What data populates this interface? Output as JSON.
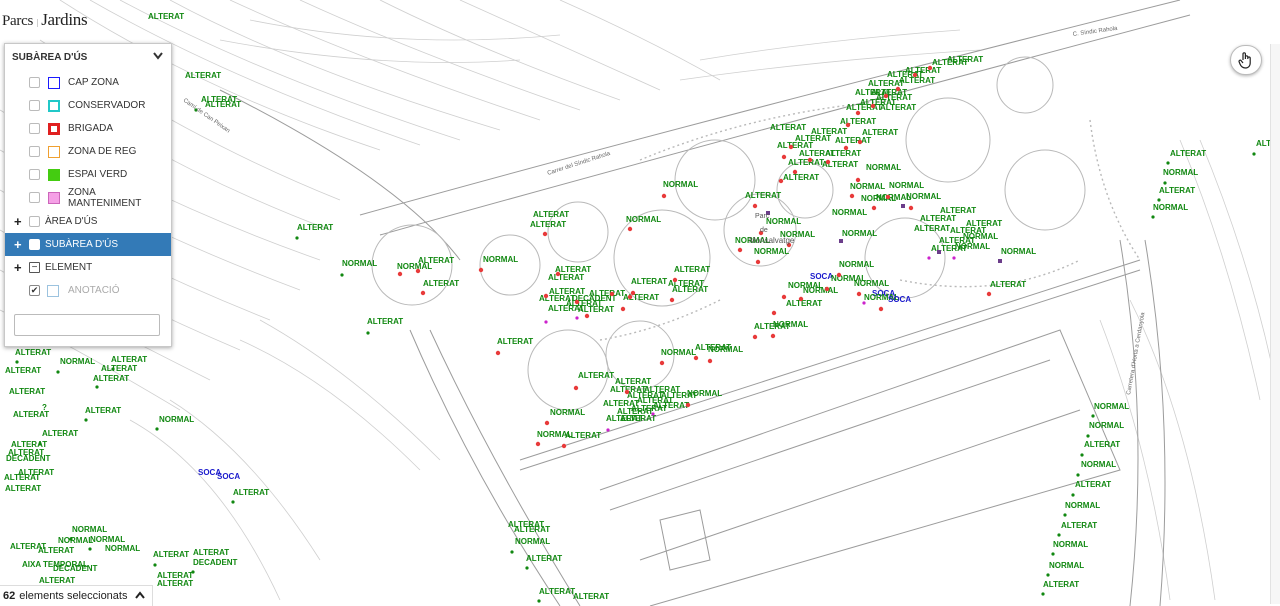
{
  "brand": {
    "part1": "Parcs",
    "part2": "Jardins"
  },
  "street_labels": [
    "Carrer del Síndic Rahola",
    "C. Síndic Rahola",
    "Camí de Can Peixan",
    "Carretera d'Horta a Cerdanyola"
  ],
  "park_labels": [
    "Parc",
    "de",
    "Monsalvatge"
  ],
  "panel": {
    "title": "SUBÀREA D'ÚS",
    "legend": [
      {
        "label": "CAP ZONA",
        "color": "#1a1aff",
        "style": "outline"
      },
      {
        "label": "CONSERVADOR",
        "color": "#21c8c8",
        "style": "dashed"
      },
      {
        "label": "BRIGADA",
        "color": "#e02020",
        "style": "thick"
      },
      {
        "label": "ZONA DE REG",
        "color": "#f0a030",
        "style": "outline"
      },
      {
        "label": "ESPAI VERD",
        "color": "#44cc11",
        "style": "fill"
      },
      {
        "label": "ZONA MANTENIMENT",
        "color": "#f5a0e6",
        "style": "fillborder"
      }
    ],
    "groups": [
      {
        "label": "ÀREA D'ÚS"
      },
      {
        "label": "SUBÀREA D'ÚS"
      },
      {
        "label": "ELEMENT"
      },
      {
        "label": "ANOTACIÓ"
      }
    ],
    "search_value": ""
  },
  "colors": {
    "green": "#118811",
    "blue": "#1a1acc",
    "red": "#e83a3a",
    "purple": "#6b3d8a",
    "magenta": "#cc22cc",
    "active": "#337ab7"
  },
  "status": {
    "count": "62",
    "text": "elements seleccionats"
  },
  "tool_icon": "hand-pointer-icon",
  "map_labels": [
    [
      "ALTERAT",
      "green",
      148,
      19
    ],
    [
      "ALTERAT",
      "green",
      185,
      78
    ],
    [
      "ALTERAT",
      "green",
      201,
      102
    ],
    [
      "ALTERAT",
      "green",
      205,
      107
    ],
    [
      "ALTERAT",
      "green",
      947,
      62
    ],
    [
      "ALTERAT",
      "green",
      932,
      65
    ],
    [
      "ALTERAT",
      "green",
      905,
      73
    ],
    [
      "ALTERAT",
      "green",
      887,
      77
    ],
    [
      "ALTERAT",
      "green",
      868,
      86
    ],
    [
      "ALTERAT",
      "green",
      899,
      83
    ],
    [
      "ALTERAT",
      "green",
      871,
      95
    ],
    [
      "ALTERAT",
      "green",
      855,
      95
    ],
    [
      "ALTERAT",
      "green",
      876,
      100
    ],
    [
      "ALTERAT",
      "green",
      860,
      105
    ],
    [
      "ALTERAT",
      "green",
      880,
      110
    ],
    [
      "ALTERAT",
      "green",
      846,
      110
    ],
    [
      "ALTERAT",
      "green",
      840,
      124
    ],
    [
      "ALTERAT",
      "green",
      862,
      135
    ],
    [
      "ALTERAT",
      "green",
      770,
      130
    ],
    [
      "ALTERAT",
      "green",
      811,
      134
    ],
    [
      "ALTERAT",
      "green",
      835,
      143
    ],
    [
      "ALTERAT",
      "green",
      795,
      141
    ],
    [
      "ALTERAT",
      "green",
      777,
      148
    ],
    [
      "ALTERAT",
      "green",
      799,
      156
    ],
    [
      "ALTERAT",
      "green",
      825,
      156
    ],
    [
      "ALTERAT",
      "green",
      788,
      165
    ],
    [
      "ALTERAT",
      "green",
      822,
      167
    ],
    [
      "ALTERAT",
      "green",
      783,
      180
    ],
    [
      "ALTERAT",
      "green",
      1170,
      156
    ],
    [
      "ALTERAT",
      "green",
      1256,
      146
    ],
    [
      "NORMAL",
      "green",
      1163,
      175
    ],
    [
      "ALTERAT",
      "green",
      1159,
      193
    ],
    [
      "NORMAL",
      "green",
      1153,
      210
    ],
    [
      "NORMAL",
      "green",
      663,
      187
    ],
    [
      "NORMAL",
      "green",
      866,
      170
    ],
    [
      "NORMAL",
      "green",
      850,
      189
    ],
    [
      "NORMAL",
      "green",
      889,
      188
    ],
    [
      "NORMAL",
      "green",
      861,
      201
    ],
    [
      "NORMAL",
      "green",
      876,
      200
    ],
    [
      "NORMAL",
      "green",
      906,
      199
    ],
    [
      "NORMAL",
      "green",
      832,
      215
    ],
    [
      "ALTERAT",
      "green",
      745,
      198
    ],
    [
      "ALTERAT",
      "green",
      940,
      213
    ],
    [
      "ALTERAT",
      "green",
      920,
      221
    ],
    [
      "ALTERAT",
      "green",
      914,
      231
    ],
    [
      "ALTERAT",
      "green",
      966,
      226
    ],
    [
      "ALTERAT",
      "green",
      950,
      233
    ],
    [
      "NORMAL",
      "green",
      963,
      239
    ],
    [
      "ALTERAT",
      "green",
      939,
      243
    ],
    [
      "NORMAL",
      "green",
      955,
      249
    ],
    [
      "ALTERAT",
      "green",
      931,
      251
    ],
    [
      "NORMAL",
      "green",
      1001,
      254
    ],
    [
      "NORMAL",
      "green",
      842,
      236
    ],
    [
      "NORMAL",
      "green",
      766,
      224
    ],
    [
      "NORMAL",
      "green",
      780,
      237
    ],
    [
      "NORMAL",
      "green",
      735,
      243
    ],
    [
      "NORMAL",
      "green",
      754,
      254
    ],
    [
      "ALTERAT",
      "green",
      533,
      217
    ],
    [
      "ALTERAT",
      "green",
      530,
      227
    ],
    [
      "NORMAL",
      "green",
      626,
      222
    ],
    [
      "ALTERAT",
      "green",
      297,
      230
    ],
    [
      "NORMAL",
      "green",
      342,
      266
    ],
    [
      "ALTERAT",
      "green",
      418,
      263
    ],
    [
      "NORMAL",
      "green",
      397,
      269
    ],
    [
      "ALTERAT",
      "green",
      423,
      286
    ],
    [
      "NORMAL",
      "green",
      483,
      262
    ],
    [
      "ALTERAT",
      "green",
      555,
      272
    ],
    [
      "ALTERAT",
      "green",
      674,
      272
    ],
    [
      "ALTERAT",
      "green",
      548,
      280
    ],
    [
      "ALTERAT",
      "green",
      549,
      294
    ],
    [
      "ALTERAT",
      "green",
      589,
      296
    ],
    [
      "DECADENT",
      "green",
      572,
      301
    ],
    [
      "ALTERAT",
      "green",
      539,
      301
    ],
    [
      "ALTERAT",
      "green",
      566,
      306
    ],
    [
      "ALTERAT",
      "green",
      631,
      284
    ],
    [
      "ALTERAT",
      "green",
      668,
      286
    ],
    [
      "ALTERAT",
      "green",
      672,
      292
    ],
    [
      "ALTERAT",
      "green",
      623,
      300
    ],
    [
      "ALTERAT",
      "green",
      548,
      311
    ],
    [
      "ALTERAT",
      "green",
      578,
      312
    ],
    [
      "ALTERAT",
      "green",
      367,
      324
    ],
    [
      "ALTERAT",
      "green",
      497,
      344
    ],
    [
      "NORMAL",
      "green",
      839,
      267
    ],
    [
      "SOCA",
      "blue",
      810,
      279
    ],
    [
      "NORMAL",
      "green",
      831,
      281
    ],
    [
      "NORMAL",
      "green",
      788,
      288
    ],
    [
      "NORMAL",
      "green",
      854,
      286
    ],
    [
      "NORMAL",
      "green",
      803,
      293
    ],
    [
      "SOCA",
      "blue",
      872,
      296
    ],
    [
      "NORMAL",
      "green",
      864,
      300
    ],
    [
      "SOCA",
      "blue",
      888,
      302
    ],
    [
      "ALTERAT",
      "green",
      990,
      287
    ],
    [
      "ALTERAT",
      "green",
      786,
      306
    ],
    [
      "NORMAL",
      "green",
      773,
      327
    ],
    [
      "ALTERAT",
      "green",
      754,
      329
    ],
    [
      "NORMAL",
      "green",
      661,
      355
    ],
    [
      "ALTERAT",
      "green",
      695,
      350
    ],
    [
      "NORMAL",
      "green",
      708,
      352
    ],
    [
      "ALTERAT",
      "green",
      578,
      378
    ],
    [
      "ALTERAT",
      "green",
      615,
      384
    ],
    [
      "ALTERAT",
      "green",
      610,
      392
    ],
    [
      "ALTERAT",
      "green",
      644,
      392
    ],
    [
      "ALTERAT",
      "green",
      627,
      398
    ],
    [
      "ALTERAT",
      "green",
      661,
      398
    ],
    [
      "ALTERAT",
      "green",
      637,
      403
    ],
    [
      "ALTERAT",
      "green",
      603,
      406
    ],
    [
      "ALTERAT",
      "green",
      653,
      408
    ],
    [
      "ALTERAT",
      "green",
      631,
      411
    ],
    [
      "ALTERAT",
      "green",
      617,
      414
    ],
    [
      "ALTERAT",
      "green",
      606,
      421
    ],
    [
      "ALTERAT",
      "green",
      620,
      421
    ],
    [
      "NORMAL",
      "green",
      687,
      396
    ],
    [
      "NORMAL",
      "green",
      550,
      415
    ],
    [
      "NORMAL",
      "green",
      537,
      437
    ],
    [
      "ALTERAT",
      "green",
      565,
      438
    ],
    [
      "ALTERAT",
      "green",
      15,
      355
    ],
    [
      "NORMAL",
      "green",
      60,
      364
    ],
    [
      "ALTERAT",
      "green",
      111,
      362
    ],
    [
      "ALTERAT",
      "green",
      101,
      371
    ],
    [
      "ALTERAT",
      "green",
      93,
      381
    ],
    [
      "ALTERAT",
      "green",
      5,
      373
    ],
    [
      "ALTERAT",
      "green",
      9,
      394
    ],
    [
      "ALTERAT",
      "green",
      85,
      413
    ],
    [
      "ALTERAT",
      "green",
      13,
      417
    ],
    [
      "?",
      "green",
      42,
      410
    ],
    [
      "NORMAL",
      "green",
      159,
      422
    ],
    [
      "ALTERAT",
      "green",
      42,
      436
    ],
    [
      "ALTERAT",
      "green",
      11,
      447
    ],
    [
      "ALTERAT",
      "green",
      8,
      455
    ],
    [
      "DECADENT",
      "green",
      6,
      461
    ],
    [
      "ALTERAT",
      "green",
      18,
      475
    ],
    [
      "ALTERAT",
      "green",
      4,
      480
    ],
    [
      "ALTERAT",
      "green",
      5,
      491
    ],
    [
      "SOCA",
      "blue",
      198,
      475
    ],
    [
      "SOCA",
      "blue",
      217,
      479
    ],
    [
      "ALTERAT",
      "green",
      233,
      495
    ],
    [
      "ALTERAT",
      "green",
      508,
      527
    ],
    [
      "ALTERAT",
      "green",
      514,
      532
    ],
    [
      "NORMAL",
      "green",
      515,
      544
    ],
    [
      "NORMAL",
      "green",
      72,
      532
    ],
    [
      "NORMAL",
      "green",
      90,
      542
    ],
    [
      "NORMAL",
      "green",
      58,
      543
    ],
    [
      "NORMAL",
      "green",
      105,
      551
    ],
    [
      "ALTERAT",
      "green",
      38,
      553
    ],
    [
      "ALTERAT",
      "green",
      10,
      549
    ],
    [
      "ALTERAT",
      "green",
      153,
      557
    ],
    [
      "ALTERAT",
      "green",
      193,
      555
    ],
    [
      "DECADENT",
      "green",
      193,
      565
    ],
    [
      "ALTERAT",
      "green",
      526,
      561
    ],
    [
      "AIXA TEMPORAL",
      "green",
      22,
      567
    ],
    [
      "DECADENT",
      "green",
      53,
      571
    ],
    [
      "ALTERAT",
      "green",
      157,
      578
    ],
    [
      "ALTERAT",
      "green",
      39,
      583
    ],
    [
      "ALTERAT",
      "green",
      157,
      586
    ],
    [
      "ALTERAT",
      "green",
      539,
      594
    ],
    [
      "ALTERAT",
      "green",
      573,
      599
    ],
    [
      "NORMAL",
      "green",
      1094,
      409
    ],
    [
      "NORMAL",
      "green",
      1089,
      428
    ],
    [
      "ALTERAT",
      "green",
      1084,
      447
    ],
    [
      "NORMAL",
      "green",
      1081,
      467
    ],
    [
      "ALTERAT",
      "green",
      1075,
      487
    ],
    [
      "NORMAL",
      "green",
      1065,
      508
    ],
    [
      "ALTERAT",
      "green",
      1061,
      528
    ],
    [
      "NORMAL",
      "green",
      1053,
      547
    ],
    [
      "NORMAL",
      "green",
      1049,
      568
    ],
    [
      "ALTERAT",
      "green",
      1043,
      587
    ]
  ],
  "map_points": [
    [
      "red",
      930,
      68
    ],
    [
      "red",
      915,
      75
    ],
    [
      "red",
      898,
      89
    ],
    [
      "red",
      886,
      96
    ],
    [
      "red",
      873,
      106
    ],
    [
      "red",
      858,
      113
    ],
    [
      "red",
      848,
      125
    ],
    [
      "red",
      860,
      142
    ],
    [
      "red",
      846,
      148
    ],
    [
      "red",
      791,
      147
    ],
    [
      "red",
      784,
      157
    ],
    [
      "red",
      810,
      160
    ],
    [
      "red",
      828,
      162
    ],
    [
      "red",
      795,
      172
    ],
    [
      "red",
      781,
      181
    ],
    [
      "red",
      664,
      196
    ],
    [
      "red",
      755,
      206
    ],
    [
      "red",
      858,
      180
    ],
    [
      "red",
      852,
      196
    ],
    [
      "red",
      888,
      197
    ],
    [
      "red",
      874,
      208
    ],
    [
      "red",
      911,
      208
    ],
    [
      "red",
      545,
      234
    ],
    [
      "red",
      558,
      274
    ],
    [
      "red",
      675,
      280
    ],
    [
      "red",
      633,
      293
    ],
    [
      "red",
      612,
      294
    ],
    [
      "red",
      672,
      300
    ],
    [
      "red",
      546,
      296
    ],
    [
      "red",
      577,
      302
    ],
    [
      "red",
      630,
      297
    ],
    [
      "red",
      623,
      309
    ],
    [
      "red",
      587,
      316
    ],
    [
      "red",
      418,
      271
    ],
    [
      "red",
      400,
      274
    ],
    [
      "red",
      481,
      270
    ],
    [
      "red",
      423,
      293
    ],
    [
      "red",
      630,
      229
    ],
    [
      "red",
      761,
      233
    ],
    [
      "red",
      789,
      245
    ],
    [
      "red",
      740,
      250
    ],
    [
      "red",
      758,
      262
    ],
    [
      "red",
      839,
      275
    ],
    [
      "red",
      827,
      289
    ],
    [
      "red",
      859,
      294
    ],
    [
      "red",
      784,
      297
    ],
    [
      "red",
      774,
      313
    ],
    [
      "red",
      773,
      336
    ],
    [
      "red",
      755,
      337
    ],
    [
      "red",
      801,
      299
    ],
    [
      "red",
      881,
      309
    ],
    [
      "red",
      696,
      358
    ],
    [
      "red",
      710,
      361
    ],
    [
      "red",
      662,
      363
    ],
    [
      "red",
      576,
      388
    ],
    [
      "red",
      627,
      392
    ],
    [
      "red",
      688,
      405
    ],
    [
      "red",
      547,
      423
    ],
    [
      "red",
      538,
      444
    ],
    [
      "red",
      564,
      446
    ],
    [
      "red",
      989,
      294
    ],
    [
      "red",
      498,
      353
    ],
    [
      "green",
      170,
      75
    ],
    [
      "green",
      196,
      110
    ],
    [
      "green",
      297,
      238
    ],
    [
      "green",
      342,
      275
    ],
    [
      "green",
      368,
      333
    ],
    [
      "green",
      1168,
      163
    ],
    [
      "green",
      1165,
      183
    ],
    [
      "green",
      1159,
      200
    ],
    [
      "green",
      1153,
      217
    ],
    [
      "green",
      1254,
      154
    ],
    [
      "green",
      1093,
      416
    ],
    [
      "green",
      1088,
      436
    ],
    [
      "green",
      1082,
      455
    ],
    [
      "green",
      1078,
      475
    ],
    [
      "green",
      1073,
      495
    ],
    [
      "green",
      1065,
      515
    ],
    [
      "green",
      1059,
      535
    ],
    [
      "green",
      1053,
      554
    ],
    [
      "green",
      1048,
      575
    ],
    [
      "green",
      1043,
      594
    ],
    [
      "green",
      17,
      362
    ],
    [
      "green",
      58,
      372
    ],
    [
      "green",
      113,
      369
    ],
    [
      "green",
      97,
      387
    ],
    [
      "green",
      86,
      420
    ],
    [
      "green",
      157,
      429
    ],
    [
      "green",
      40,
      444
    ],
    [
      "green",
      233,
      502
    ],
    [
      "green",
      71,
      539
    ],
    [
      "green",
      90,
      549
    ],
    [
      "green",
      155,
      565
    ],
    [
      "green",
      193,
      572
    ],
    [
      "green",
      512,
      552
    ],
    [
      "green",
      527,
      568
    ],
    [
      "green",
      539,
      601
    ],
    [
      "purple",
      768,
      213
    ],
    [
      "purple",
      841,
      241
    ],
    [
      "purple",
      939,
      252
    ],
    [
      "purple",
      1000,
      261
    ],
    [
      "purple",
      903,
      206
    ],
    [
      "magenta",
      546,
      322
    ],
    [
      "magenta",
      577,
      318
    ],
    [
      "magenta",
      608,
      430
    ],
    [
      "magenta",
      653,
      414
    ],
    [
      "magenta",
      929,
      258
    ],
    [
      "magenta",
      954,
      258
    ],
    [
      "magenta",
      864,
      303
    ]
  ]
}
